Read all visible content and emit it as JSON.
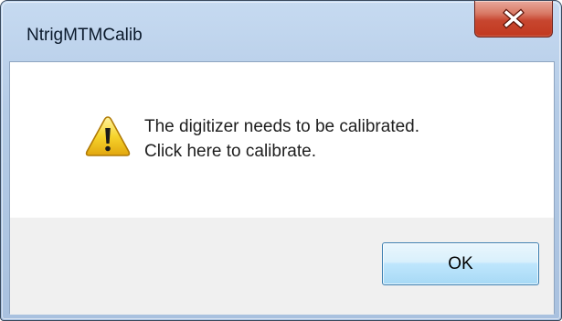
{
  "window": {
    "title": "NtrigMTMCalib",
    "close_icon": "close-x-icon"
  },
  "message": {
    "icon": "warning-icon",
    "line1": "The digitizer needs to be calibrated.",
    "line2": "Click here to calibrate."
  },
  "buttons": {
    "ok_label": "OK"
  },
  "colors": {
    "close_button": "#c7462f",
    "warning_yellow": "#f6d42c",
    "button_area_bg": "#f0f0f0"
  }
}
